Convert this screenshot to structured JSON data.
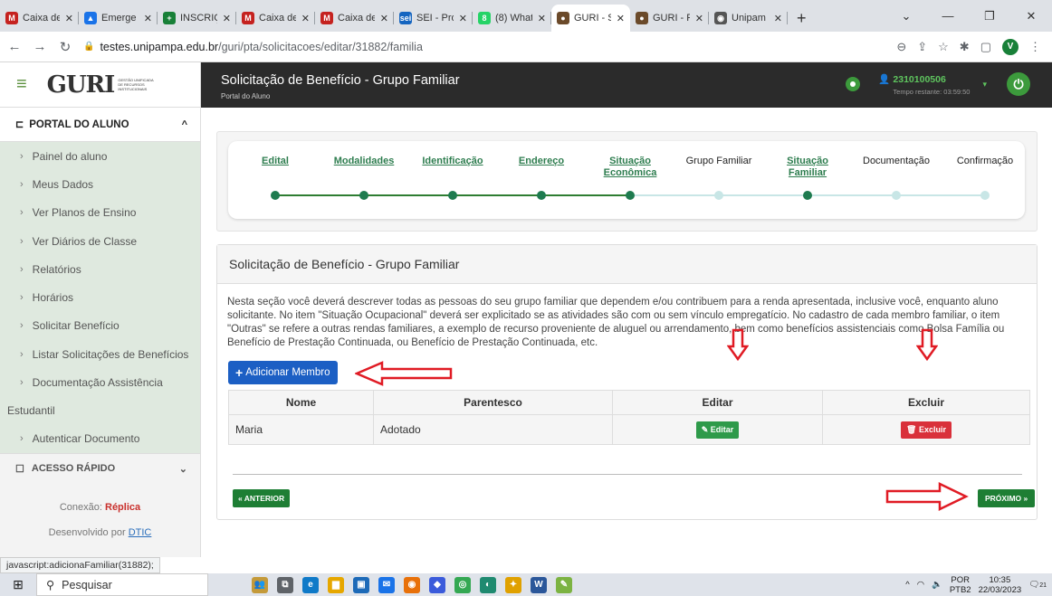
{
  "browser": {
    "tabs": [
      {
        "label": "Caixa de",
        "color": "#c5221f",
        "glyph": "M",
        "active": false
      },
      {
        "label": "Emerge",
        "color": "#1a73e8",
        "glyph": "▲",
        "active": false
      },
      {
        "label": "INSCRIÇ",
        "color": "#188038",
        "glyph": "+",
        "active": false
      },
      {
        "label": "Caixa de",
        "color": "#c5221f",
        "glyph": "M",
        "active": false
      },
      {
        "label": "Caixa de",
        "color": "#c5221f",
        "glyph": "M",
        "active": false
      },
      {
        "label": "SEI - Pro",
        "color": "#1565c0",
        "glyph": "sei",
        "active": false
      },
      {
        "label": "(8) What",
        "color": "#25d366",
        "glyph": "8",
        "active": false
      },
      {
        "label": "GURI - S",
        "color": "#6b4a2a",
        "glyph": "●",
        "active": true
      },
      {
        "label": "GURI - F",
        "color": "#6b4a2a",
        "glyph": "●",
        "active": false
      },
      {
        "label": "Unipam",
        "color": "#555555",
        "glyph": "◉",
        "active": false
      }
    ],
    "new_tab": "+",
    "url_host": "testes.unipampa.edu.br",
    "url_path": "/guri/pta/solicitacoes/editar/31882/familia",
    "profile_initial": "V",
    "status_url": "javascript:adicionaFamiliar(31882);"
  },
  "sidebar": {
    "section_title": "PORTAL DO ALUNO",
    "items": [
      "Painel do aluno",
      "Meus Dados",
      "Ver Planos de Ensino",
      "Ver Diários de Classe",
      "Relatórios",
      "Horários",
      "Solicitar Benefício",
      "Listar Solicitações de Benefícios",
      "Documentação Assistência"
    ],
    "item_continuation": "Estudantil",
    "last_item": "Autenticar Documento",
    "quick_access": "ACESSO RÁPIDO",
    "connection_label": "Conexão:",
    "connection_value": "Réplica",
    "developed_by": "Desenvolvido por",
    "developer": "DTIC"
  },
  "header": {
    "title": "Solicitação de Benefício - Grupo Familiar",
    "breadcrumb": "Portal do Aluno",
    "user_id": "2310100506",
    "time_left": "Tempo restante: 03:59:50"
  },
  "stepper": {
    "steps": [
      {
        "label": "Edital",
        "link": true,
        "done": true
      },
      {
        "label": "Modalidades",
        "link": true,
        "done": true
      },
      {
        "label": "Identificação",
        "link": true,
        "done": true
      },
      {
        "label": "Endereço",
        "link": true,
        "done": true
      },
      {
        "label": "Situação Econômica",
        "link": true,
        "done": true
      },
      {
        "label": "Grupo Familiar",
        "link": false,
        "done": false
      },
      {
        "label": "Situação Familiar",
        "link": true,
        "done": true
      },
      {
        "label": "Documentação",
        "link": false,
        "done": false
      },
      {
        "label": "Confirmação",
        "link": false,
        "done": false
      }
    ]
  },
  "panel": {
    "title": "Solicitação de Benefício - Grupo Familiar",
    "description": "Nesta seção você deverá descrever todas as pessoas do seu grupo familiar que dependem e/ou contribuem para a renda apresentada, inclusive você, enquanto aluno solicitante. No item \"Situação Ocupacional\" deverá ser explicitado se as atividades são com ou sem vínculo empregatício. No cadastro de cada membro familiar, o item \"Outras\" se refere a outras rendas familiares, a exemplo de recurso proveniente de aluguel ou arrendamento, bem como benefícios assistenciais como Bolsa Família ou Benefício de Prestação Continuada, ou Benefício de Prestação Continuada, etc.",
    "add_member": "Adicionar Membro",
    "columns": [
      "Nome",
      "Parentesco",
      "Editar",
      "Excluir"
    ],
    "rows": [
      {
        "nome": "Maria",
        "parentesco": "Adotado",
        "edit": "Editar",
        "delete": "Excluir"
      }
    ],
    "prev": "« ANTERIOR",
    "next": "PRÓXIMO »"
  },
  "taskbar": {
    "search": "Pesquisar",
    "lang": "POR",
    "lang2": "PTB2",
    "time": "10:35",
    "date": "22/03/2023",
    "notif": "21"
  },
  "colors": {
    "accent_green": "#1e7e34",
    "add_blue": "#1c5fc4",
    "annotation_red": "#e01b24"
  }
}
